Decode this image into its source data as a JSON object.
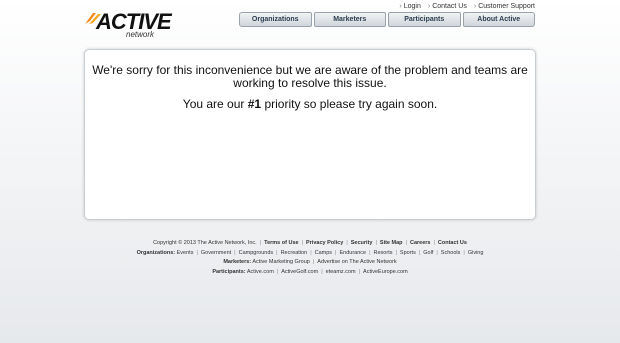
{
  "logo": {
    "text": "ACTIVE",
    "sub": "network",
    "mark": "orange-swoosh"
  },
  "toplinks": [
    {
      "label": "Login"
    },
    {
      "label": "Contact Us"
    },
    {
      "label": "Customer Support"
    }
  ],
  "nav": {
    "tabs": [
      {
        "label": "Organizations"
      },
      {
        "label": "Marketers"
      },
      {
        "label": "Participants"
      },
      {
        "label": "About Active"
      }
    ]
  },
  "message": {
    "line1": "We're sorry for this inconvenience but we are aware of the problem and teams are",
    "line2": "working to resolve this issue.",
    "line3_pre": "You are our ",
    "line3_bold": "#1",
    "line3_post": " priority so please try again soon."
  },
  "footer": {
    "copyright": "Copyright © 2013 The Active Network, Inc.",
    "links": [
      "Terms of Use",
      "Privacy Policy",
      "Security",
      "Site Map",
      "Careers",
      "Contact Us"
    ],
    "organizations_label": "Organizations:",
    "organizations": [
      "Events",
      "Government",
      "Campgrounds",
      "Recreation",
      "Camps",
      "Endurance",
      "Resorts",
      "Sports",
      "Golf",
      "Schools",
      "Giving"
    ],
    "marketers_label": "Marketers:",
    "marketers": [
      "Active Marketing Group",
      "Advertise on The Active Network"
    ],
    "participants_label": "Participants:",
    "participants": [
      "Active.com",
      "ActiveGolf.com",
      "eteamz.com",
      "ActiveEurope.com"
    ]
  }
}
